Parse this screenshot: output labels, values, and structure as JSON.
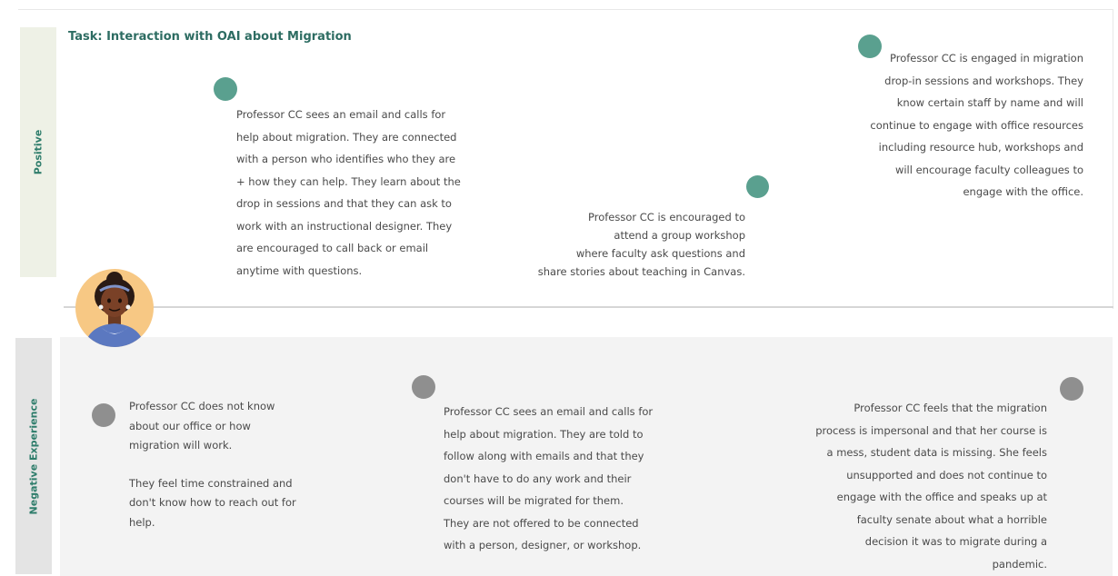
{
  "title": "Task: Interaction with OAI about Migration",
  "lanes": {
    "positive": "Positive",
    "negative": "Negative Experience"
  },
  "colors": {
    "positive_dot": "#5aa08f",
    "negative_dot": "#8f8f8f",
    "title": "#2d6c62",
    "positive_band": "#eef1e6",
    "negative_band": "#e4e4e4"
  },
  "avatar": {
    "icon": "persona-avatar-icon"
  },
  "notes": {
    "pos_1": [
      "Professor CC sees an email and calls for",
      "help about migration. They are connected",
      "with a person who identifies who they are",
      "+ how they can help. They learn about the",
      "drop in sessions and that they can ask to",
      "work with an instructional designer. They",
      "are encouraged to call back or email",
      "anytime with questions."
    ],
    "pos_2": [
      "Professor CC is encouraged to",
      "attend a group workshop",
      "where faculty ask questions and",
      "share stories about teaching in Canvas."
    ],
    "pos_3": [
      "Professor CC is engaged in migration",
      "drop-in sessions and workshops. They",
      "know certain staff by name and will",
      "continue to engage with office resources",
      "including resource hub, workshops and",
      "will encourage faculty colleagues to",
      "engage with the office."
    ],
    "neg_1a": [
      "Professor CC does not know",
      "about our office or how",
      "migration will work."
    ],
    "neg_1b": [
      "They feel time constrained and",
      "don't know how to reach out for",
      "help."
    ],
    "neg_2": [
      "Professor CC sees an email and calls for",
      "help about migration. They are told to",
      "follow along with emails and that they",
      "don't have to do any work and their",
      "courses will be migrated for them.",
      "They are not offered to be connected",
      "with a person, designer, or workshop."
    ],
    "neg_3": [
      "Professor CC feels that the migration",
      "process is impersonal and that her course is",
      "a mess, student data is missing. She feels",
      "unsupported and does not continue to",
      "engage with the office and speaks up at",
      "faculty senate about what a horrible",
      "decision it was to migrate during a",
      "pandemic."
    ]
  }
}
